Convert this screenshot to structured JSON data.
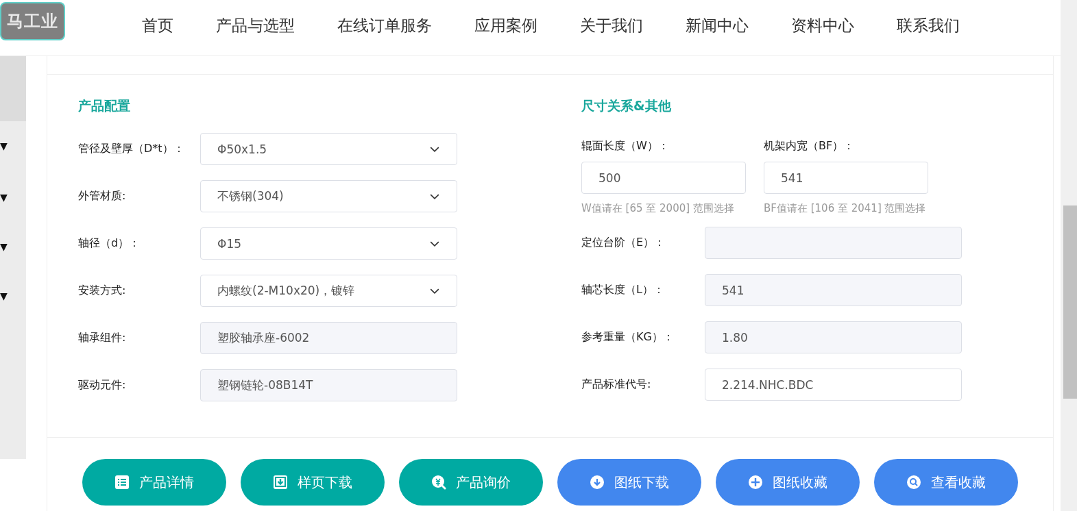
{
  "logo": {
    "text": "马工业"
  },
  "nav": [
    "首页",
    "产品与选型",
    "在线订单服务",
    "应用案例",
    "关于我们",
    "新闻中心",
    "资料中心",
    "联系我们"
  ],
  "sidebar": {
    "toggles": [
      "▼",
      "▼",
      "▼",
      "▼"
    ]
  },
  "config": {
    "title": "产品配置",
    "fields": [
      {
        "label": "管径及壁厚（D*t）：",
        "value": "Φ50x1.5",
        "kind": "select"
      },
      {
        "label": "外管材质:",
        "value": "不锈钢(304)",
        "kind": "select"
      },
      {
        "label": "轴径（d）：",
        "value": "Φ15",
        "kind": "select"
      },
      {
        "label": "安装方式:",
        "value": "内螺纹(2-M10x20)，镀锌",
        "kind": "select"
      },
      {
        "label": "轴承组件:",
        "value": "塑胶轴承座-6002",
        "kind": "readonly"
      },
      {
        "label": "驱动元件:",
        "value": "塑钢链轮-08B14T",
        "kind": "readonly"
      }
    ]
  },
  "dimensions": {
    "title": "尺寸关系&其他",
    "inputs": [
      {
        "label": "辊面长度（W）：",
        "value": "500",
        "hint": "W值请在 [65 至 2000] 范围选择"
      },
      {
        "label": "机架内宽（BF）：",
        "value": "541",
        "hint": "BF值请在 [106 至 2041] 范围选择"
      }
    ],
    "fields": [
      {
        "label": "定位台阶（E）：",
        "kind": "readonly"
      },
      {
        "label": "轴芯长度（L）：",
        "value": "541",
        "kind": "readonly"
      },
      {
        "label": "参考重量（KG）：",
        "value": "1.80",
        "kind": "readonly"
      },
      {
        "label": "产品标准代号:",
        "value": "2.214.NHC.BDC",
        "kind": "input"
      }
    ]
  },
  "actions": [
    {
      "label": "产品详情",
      "kind": "list",
      "color": "#00aaa2"
    },
    {
      "label": "样页下载",
      "kind": "tray",
      "color": "#00aaa2"
    },
    {
      "label": "产品询价",
      "kind": "price",
      "color": "#00aaa2"
    },
    {
      "label": "图纸下载",
      "kind": "download",
      "color": "#4287ee"
    },
    {
      "label": "图纸收藏",
      "kind": "plus",
      "color": "#4287ee"
    },
    {
      "label": "查看收藏",
      "kind": "search",
      "color": "#4287ee"
    }
  ]
}
